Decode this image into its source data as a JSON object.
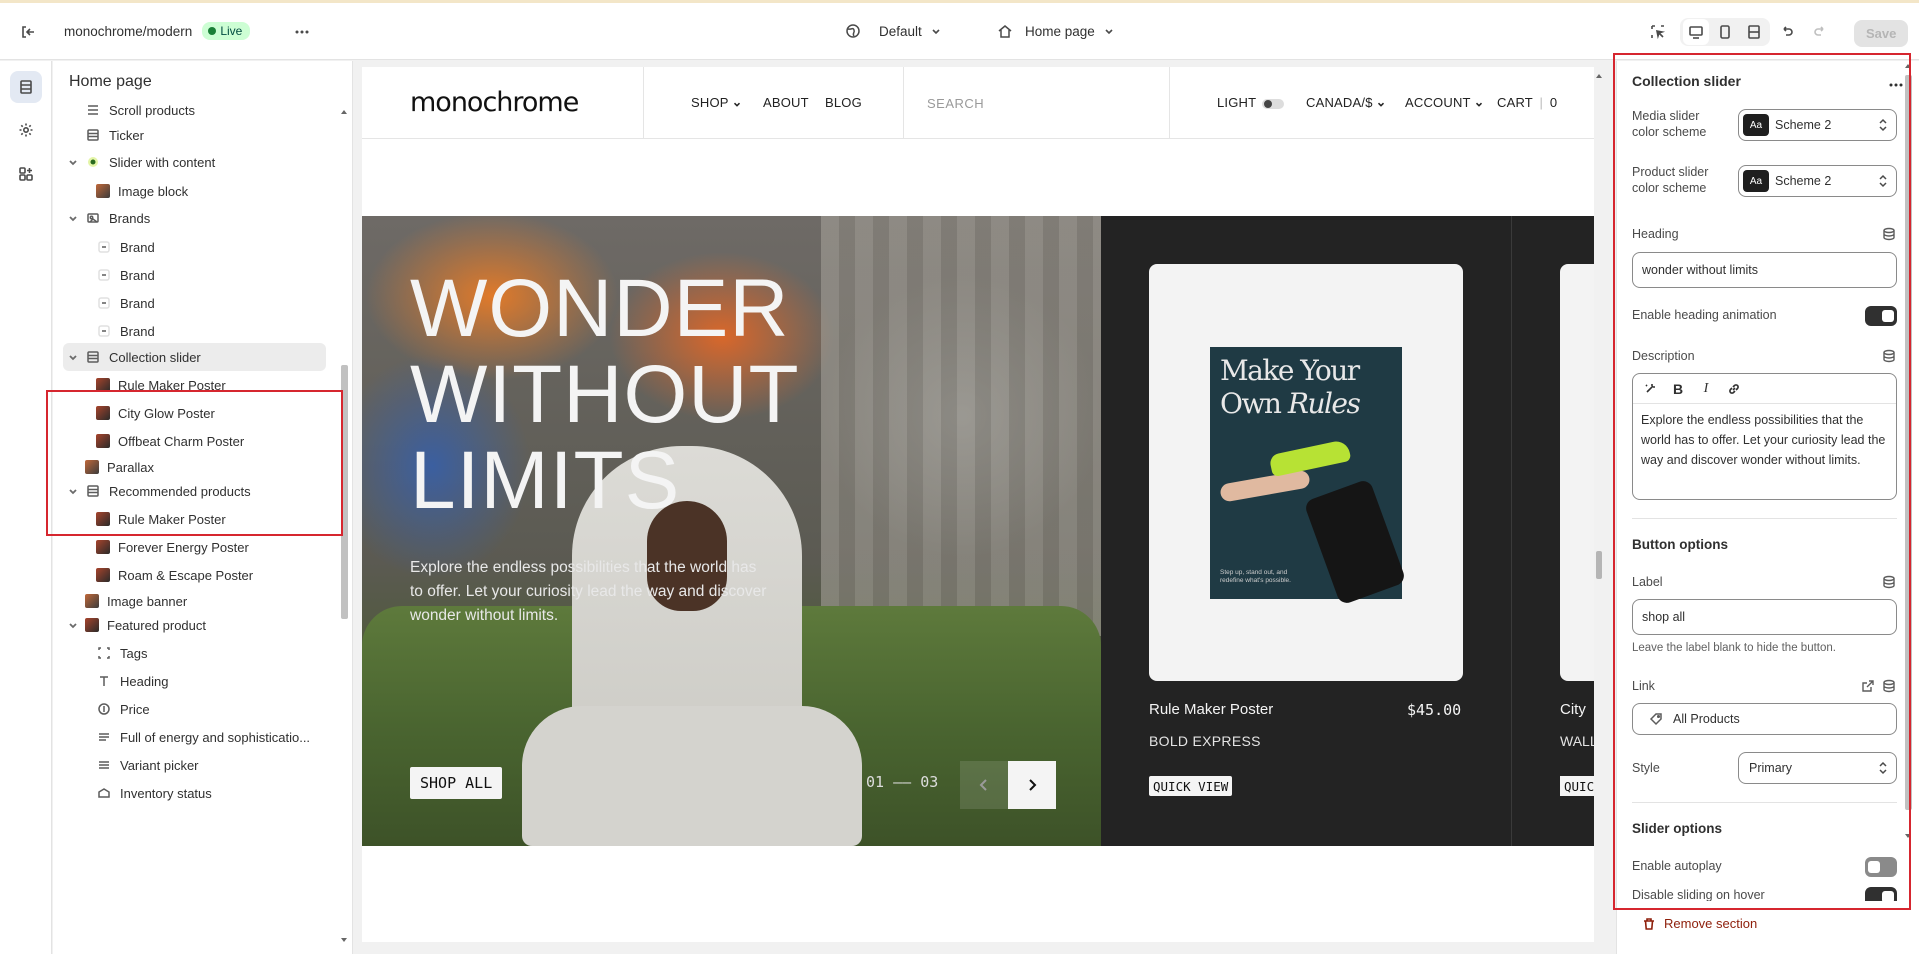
{
  "topbar": {
    "store_name": "monochrome/modern",
    "live_badge": "Live",
    "theme_selector": "Default",
    "page_selector": "Home page",
    "save_label": "Save"
  },
  "left_panel": {
    "title": "Home page",
    "items": [
      {
        "label": "Scroll products",
        "depth": 1,
        "icon": "product-list-icon"
      },
      {
        "label": "Ticker",
        "depth": 1,
        "icon": "section-icon"
      },
      {
        "label": "Slider with content",
        "depth": 1,
        "icon": "slider-icon",
        "expanded": true
      },
      {
        "label": "Image block",
        "depth": 2,
        "icon": "image-thumb"
      },
      {
        "label": "Brands",
        "depth": 1,
        "icon": "brand-icon",
        "expanded": true
      },
      {
        "label": "Brand",
        "depth": 2,
        "icon": "dash-icon"
      },
      {
        "label": "Brand",
        "depth": 2,
        "icon": "dash-icon"
      },
      {
        "label": "Brand",
        "depth": 2,
        "icon": "dash-icon"
      },
      {
        "label": "Brand",
        "depth": 2,
        "icon": "dash-icon"
      },
      {
        "label": "Collection slider",
        "depth": 1,
        "icon": "section-icon",
        "expanded": true,
        "selected": true
      },
      {
        "label": "Rule Maker Poster",
        "depth": 2,
        "icon": "product-thumb"
      },
      {
        "label": "City Glow Poster",
        "depth": 2,
        "icon": "product-thumb"
      },
      {
        "label": "Offbeat Charm Poster",
        "depth": 2,
        "icon": "product-thumb"
      },
      {
        "label": "Parallax",
        "depth": 1,
        "icon": "image-thumb"
      },
      {
        "label": "Recommended products",
        "depth": 1,
        "icon": "section-icon",
        "expanded": true
      },
      {
        "label": "Rule Maker Poster",
        "depth": 2,
        "icon": "product-thumb"
      },
      {
        "label": "Forever Energy Poster",
        "depth": 2,
        "icon": "product-thumb"
      },
      {
        "label": "Roam & Escape Poster",
        "depth": 2,
        "icon": "product-thumb"
      },
      {
        "label": "Image banner",
        "depth": 1,
        "icon": "image-thumb"
      },
      {
        "label": "Featured product",
        "depth": 1,
        "icon": "product-thumb",
        "expanded": true
      },
      {
        "label": "Tags",
        "depth": 2,
        "icon": "tags-icon"
      },
      {
        "label": "Heading",
        "depth": 2,
        "icon": "heading-icon"
      },
      {
        "label": "Price",
        "depth": 2,
        "icon": "price-icon"
      },
      {
        "label": "Full of energy and sophisticatio...",
        "depth": 2,
        "icon": "text-icon"
      },
      {
        "label": "Variant picker",
        "depth": 2,
        "icon": "variant-icon"
      },
      {
        "label": "Inventory status",
        "depth": 2,
        "icon": "inventory-icon"
      }
    ]
  },
  "preview": {
    "logo": "monochrome",
    "nav": {
      "shop": "SHOP",
      "about": "ABOUT",
      "blog": "BLOG",
      "search": "SEARCH",
      "light": "LIGHT",
      "region": "CANADA/$",
      "account": "ACCOUNT",
      "cart": "CART",
      "cart_count": "0"
    },
    "hero": {
      "title_line1": "WONDER",
      "title_line2": "WITHOUT",
      "title_line3": "LIMITS",
      "description": "Explore the endless possibilities that the world has to offer. Let your curiosity lead the way and discover wonder without limits.",
      "button": "SHOP ALL",
      "counter_current": "01",
      "counter_sep": "——",
      "counter_total": "03"
    },
    "product1": {
      "poster_line1": "Make Your",
      "poster_line2_a": "Own ",
      "poster_line2_b": "Rules",
      "poster_small": "Step up, stand out, and redefine what's possible.",
      "name": "Rule Maker Poster",
      "price": "$45.00",
      "vendor": "BOLD EXPRESS",
      "quick_view": "QUICK VIEW"
    },
    "product2": {
      "name": "City",
      "vendor": "WALL",
      "quick_view": "QUIC"
    }
  },
  "right_panel": {
    "title": "Collection slider",
    "media_scheme_label": "Media slider color scheme",
    "media_scheme_value": "Scheme 2",
    "product_scheme_label": "Product slider color scheme",
    "product_scheme_value": "Scheme 2",
    "swatch_text": "Aa",
    "heading_label": "Heading",
    "heading_value": "wonder without limits",
    "heading_anim_label": "Enable heading animation",
    "heading_anim_on": true,
    "description_label": "Description",
    "description_value": "Explore the endless possibilities that the world has to offer. Let your curiosity lead the way and discover wonder without limits.",
    "button_options": "Button options",
    "label_label": "Label",
    "label_value": "shop all",
    "label_hint": "Leave the label blank to hide the button.",
    "link_label": "Link",
    "link_value": "All Products",
    "style_label": "Style",
    "style_value": "Primary",
    "slider_options": "Slider options",
    "autoplay_label": "Enable autoplay",
    "autoplay_on": false,
    "disable_hover_label": "Disable sliding on hover",
    "disable_hover_on": true,
    "remove_label": "Remove section"
  },
  "colors": {
    "live_badge_bg": "#cdfed4",
    "highlight_border": "#d6262f",
    "remove_red": "#8e1f0b",
    "slider_bg": "#232323"
  }
}
